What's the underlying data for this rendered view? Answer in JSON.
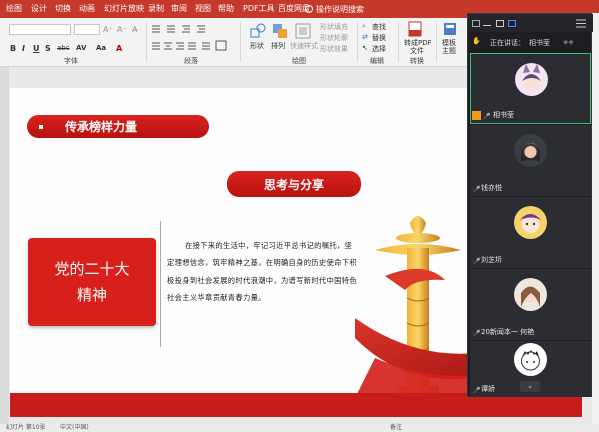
{
  "ribbon_tabs": [
    "绘图",
    "设计",
    "切换",
    "动画",
    "幻灯片放映",
    "录制",
    "审阅",
    "视图",
    "帮助",
    "PDF工具",
    "百度网盘"
  ],
  "tell_me": "操作说明搜索",
  "ribbon": {
    "groups": {
      "font": "字体",
      "paragraph": "段落",
      "drawing": "绘图",
      "editing": "编辑",
      "convert": "转换"
    },
    "font_buttons": [
      "B",
      "I",
      "U",
      "S",
      "abc",
      "AV",
      "Aa",
      "A"
    ],
    "shape_label": "形状",
    "arrange_label": "排列",
    "quick_styles_label": "快速样式",
    "shape_fill": "形状填充",
    "shape_outline": "形状轮廓",
    "shape_effects": "形状效果",
    "find": "查找",
    "replace": "替换",
    "select": "选择",
    "to_pdf": "转成PDF",
    "to_pdf_sub": "文件",
    "template": "模板",
    "template_sub": "主题"
  },
  "slide": {
    "banner_title": "传承榜样力量",
    "section_title": "思考与分享",
    "red_box_text": [
      "党的二十大",
      "精神"
    ],
    "body_paragraph": "在接下来的生活中，牢记习近平总书记的嘱托，坚定理想信念，筑牢精神之基，在明确自身的历史使命下积极投身到社会发展的时代浪潮中，为谱写新时代中国特色社会主义华章贡献青春力量。"
  },
  "status_bar": {
    "slide_info": "幻灯片 第10张",
    "lang": "中文(中国)",
    "notes": "备注"
  },
  "meeting": {
    "speaking_label": "正在讲话：",
    "speaking_name": "相书莹",
    "participants": [
      {
        "name": "相书莹"
      },
      {
        "name": "钱亦悦"
      },
      {
        "name": "刘芝圻"
      },
      {
        "name": "20新闻本一 何艳"
      },
      {
        "name": "谭娇"
      }
    ],
    "expand_icon": "chevron-down-icon"
  },
  "colors": {
    "ribbon_red": "#c5392b",
    "slide_red": "#d71f1c",
    "panel_bg": "#1d1e22",
    "active_border": "#3fbf6f"
  }
}
